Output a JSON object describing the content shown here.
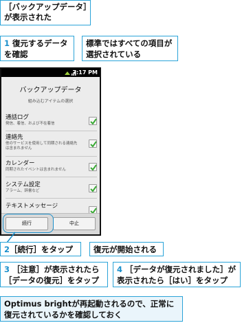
{
  "callouts": {
    "backup_data": "［バックアップデータ］\nが表示された",
    "step1_num": "1",
    "step1_text": " 復元するデータ",
    "step1_text2": "を確認",
    "all_selected_1": "標準ではすべての項目が",
    "all_selected_2": "選択されている",
    "step2_num": "2",
    "step2_text": "［続行］をタップ",
    "restore_started": "復元が開始される",
    "step3_num": "3",
    "step3_line1": "［注意］が表示されたら",
    "step3_line2": "［データの復元］をタップ",
    "step4_num": "4",
    "step4_line1": "［データが復元されました］が",
    "step4_line2": "表示されたら［はい］をタップ",
    "footer_line1": "Optimus brightが再起動されるので、正常に",
    "footer_line2": "復元されているかを確認しておく"
  },
  "phone": {
    "clock": "7:17 PM",
    "dialog_title": "バックアップデータ",
    "dialog_subtitle": "組み込むアイテムの選択",
    "items": [
      {
        "title": "通話ログ",
        "desc": "発信、着信、および不在着信",
        "checked": true
      },
      {
        "title": "連絡先",
        "desc": "他のサービスを使用して同期される連絡先は含まれません",
        "checked": true
      },
      {
        "title": "カレンダー",
        "desc": "同期されたイベントは含まれません",
        "checked": true
      },
      {
        "title": "システム設定",
        "desc": "アラーム、辞書など",
        "checked": true
      },
      {
        "title": "テキストメッセージ",
        "desc": "",
        "checked": true
      }
    ],
    "continue_label": "続行",
    "cancel_label": "中止"
  },
  "colors": {
    "accent": "#1b8fcb",
    "check": "#3aaa35"
  }
}
